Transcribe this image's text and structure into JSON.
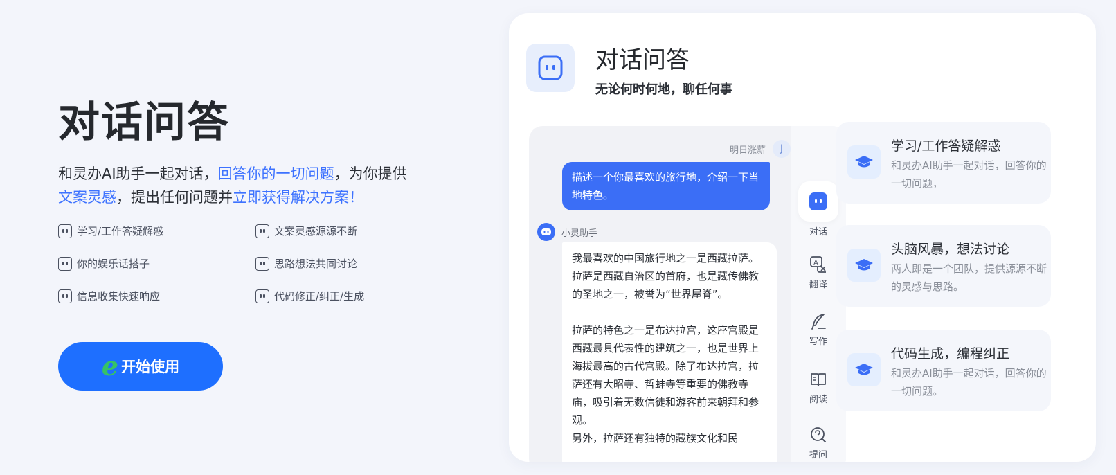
{
  "hero": {
    "title": "对话问答",
    "desc_part1": "和灵办AI助手一起对话，",
    "desc_hl1": "回答你的一切问题",
    "desc_part2": "，为你提供",
    "desc_hl2": "文案灵感",
    "desc_part3": "，提出任何问题并",
    "desc_hl3": "立即获得解决方案！",
    "features": [
      "学习/工作答疑解惑",
      "文案灵感源源不断",
      "你的娱乐话搭子",
      "思路想法共同讨论",
      "信息收集快速响应",
      "代码修正/纠正/生成"
    ],
    "start_button": "开始使用",
    "start_logo": "e",
    "highlight_color": "#3d72ff",
    "button_color": "#1e6fff"
  },
  "card": {
    "title": "对话问答",
    "subtitle": "无论何时何地，聊任何事",
    "icon": "robot-face-icon"
  },
  "chat": {
    "user_name": "明日涨薪",
    "user_avatar": "J",
    "user_message": "描述一个你最喜欢的旅行地，介绍一下当地特色。",
    "bot_name": "小灵助手",
    "bot_paragraph1": "我最喜欢的中国旅行地之一是西藏拉萨。拉萨是西藏自治区的首府，也是藏传佛教的圣地之一，被誉为“世界屋脊”。",
    "bot_paragraph2": "拉萨的特色之一是布达拉宫，这座宫殿是西藏最具代表性的建筑之一，也是世界上海拔最高的古代宫殿。除了布达拉宫，拉萨还有大昭寺、哲蚌寺等重要的佛教寺庙，吸引着无数信徒和游客前来朝拜和参观。",
    "bot_paragraph3": "另外，拉萨还有独特的藏族文化和民",
    "accent_color": "#3b6ef6"
  },
  "sidebar": {
    "items": [
      {
        "label": "对话",
        "icon": "chat-bot-icon"
      },
      {
        "label": "翻译",
        "icon": "translate-icon"
      },
      {
        "label": "写作",
        "icon": "quill-icon"
      },
      {
        "label": "阅读",
        "icon": "book-icon"
      },
      {
        "label": "提问",
        "icon": "search-question-icon"
      }
    ]
  },
  "feature_cards": [
    {
      "title": "学习/工作答疑解惑",
      "desc": "和灵办AI助手一起对话，回答你的一切问题，",
      "icon": "graduation-cap-icon"
    },
    {
      "title": "头脑风暴，想法讨论",
      "desc": "两人即是一个团队，提供源源不断的灵感与思路。",
      "icon": "graduation-cap-icon"
    },
    {
      "title": "代码生成，编程纠正",
      "desc": "和灵办AI助手一起对话，回答你的一切问题。",
      "icon": "graduation-cap-icon"
    }
  ]
}
